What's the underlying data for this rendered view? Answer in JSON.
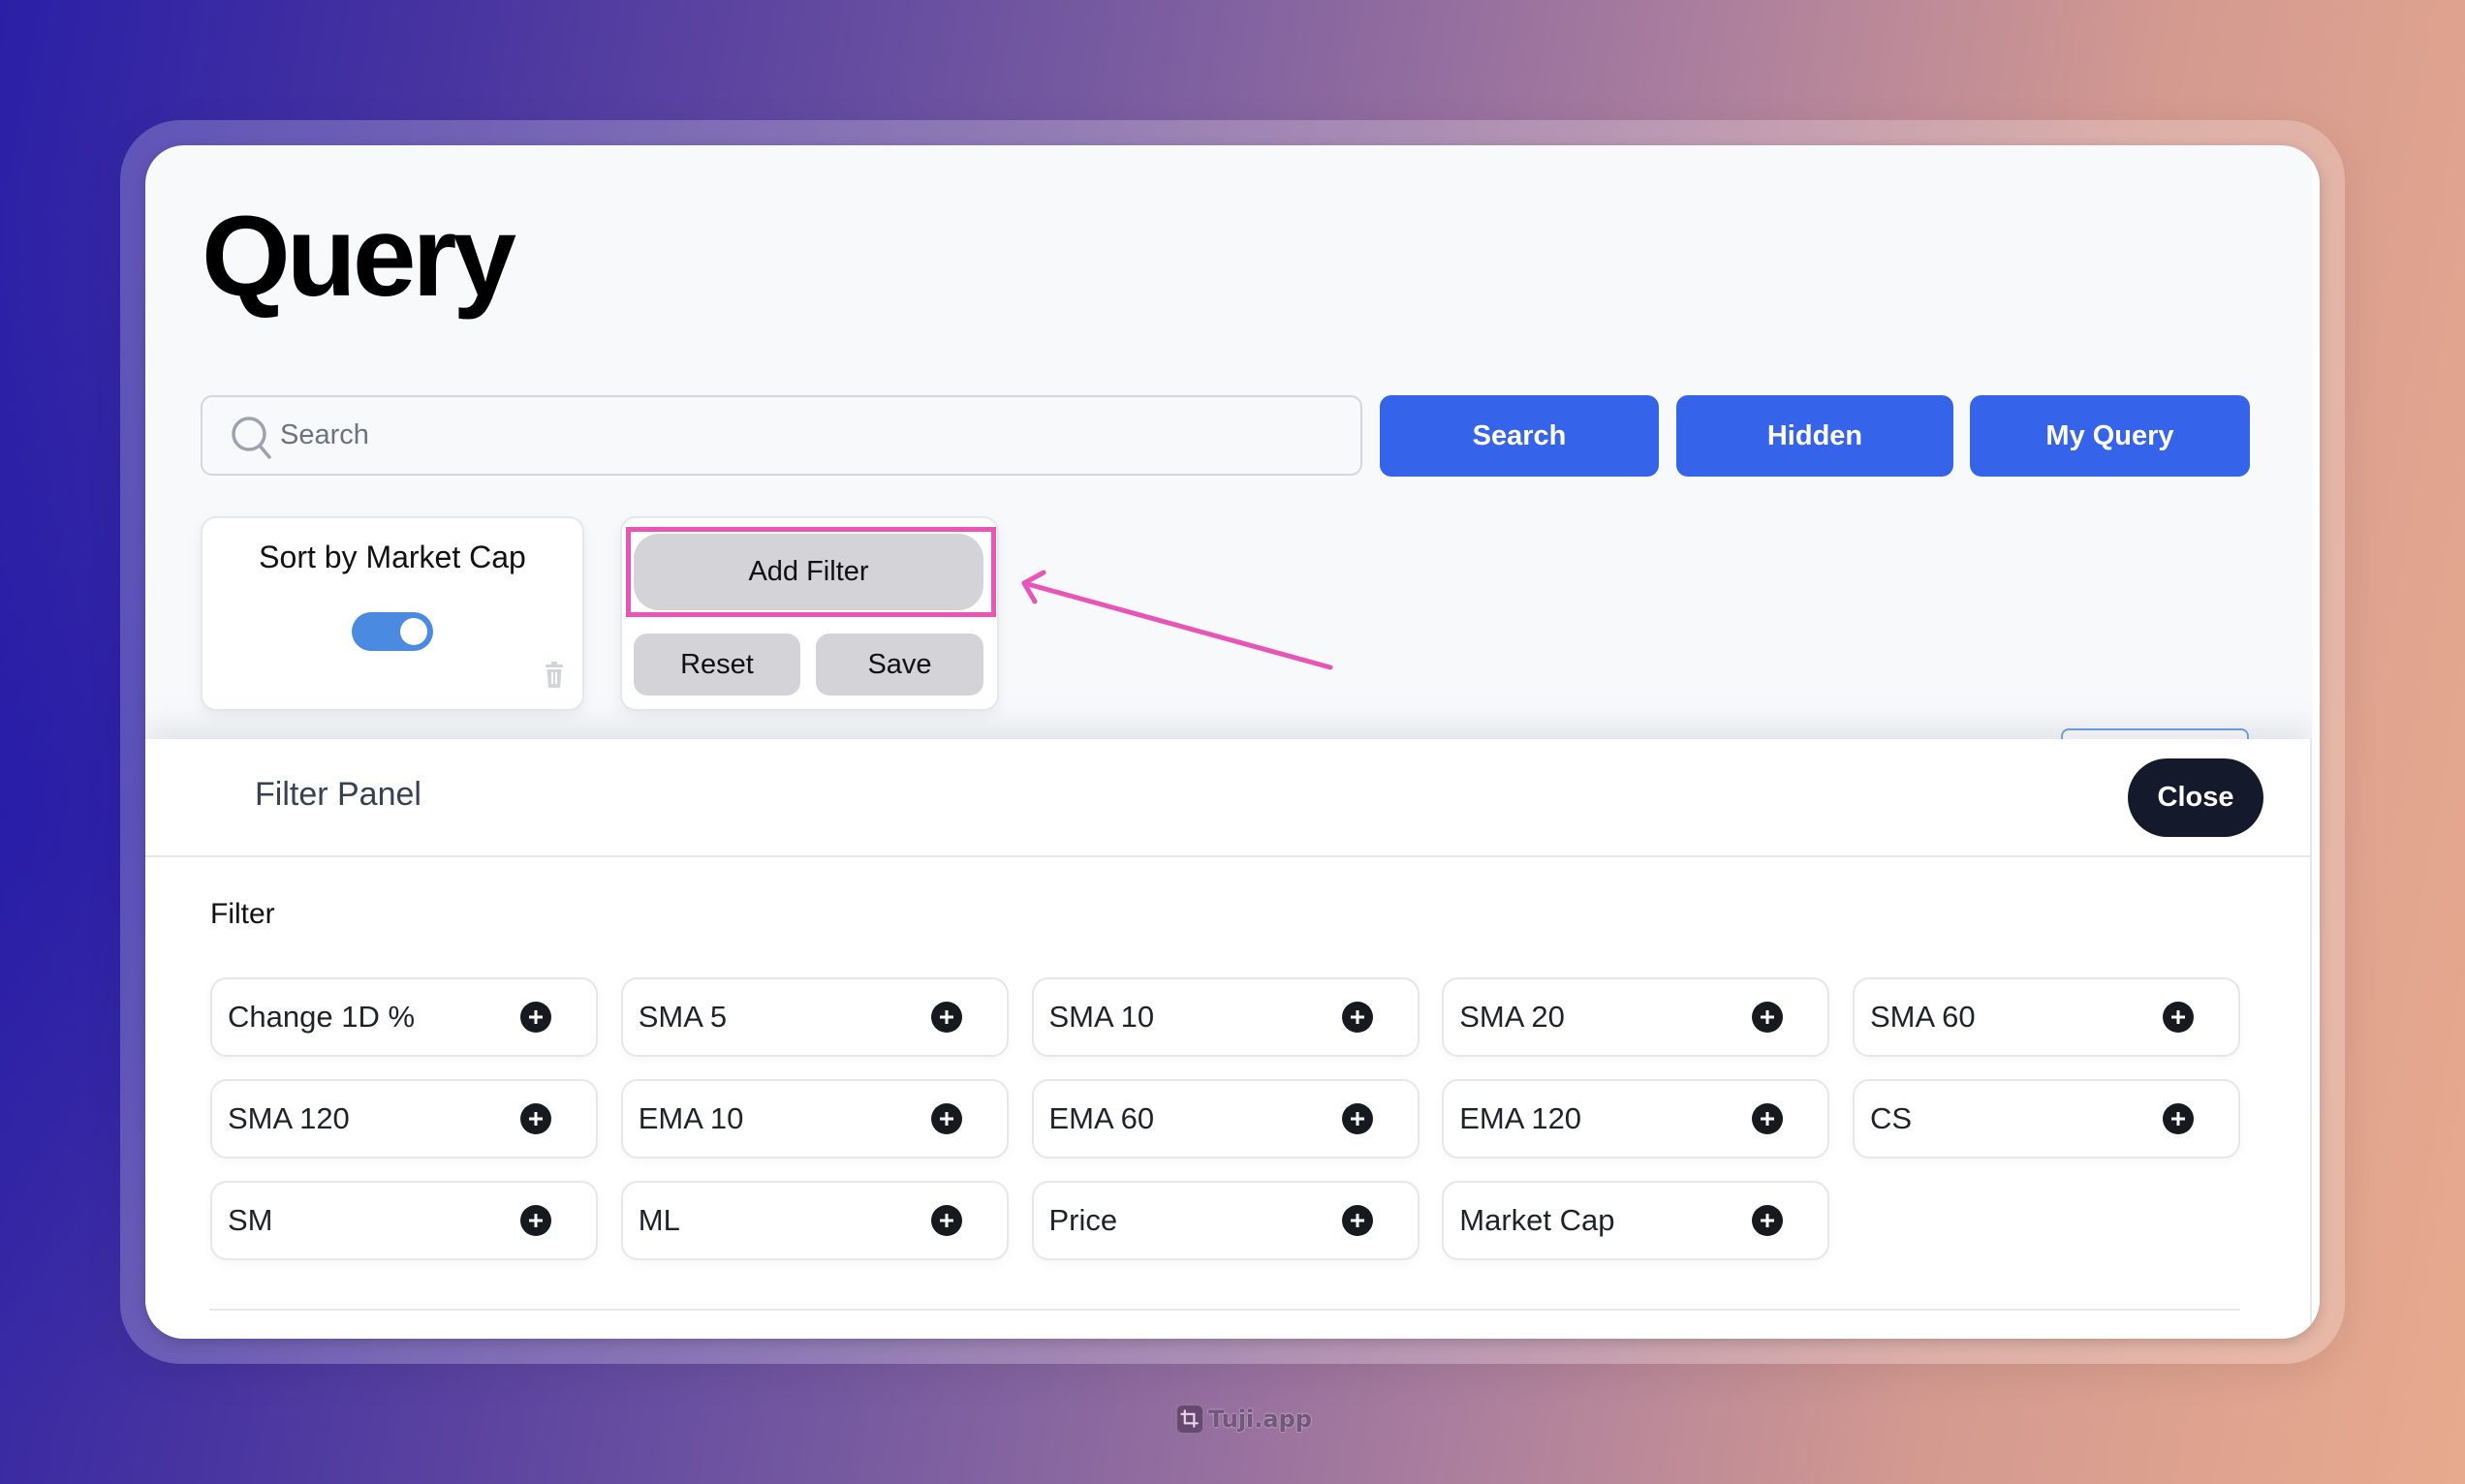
{
  "page": {
    "title": "Query"
  },
  "search": {
    "placeholder": "Search",
    "value": ""
  },
  "toolbar": {
    "search_label": "Search",
    "hidden_label": "Hidden",
    "my_query_label": "My Query"
  },
  "sort_card": {
    "title": "Sort by Market Cap",
    "toggle_on": true
  },
  "filter_actions": {
    "add_filter_label": "Add Filter",
    "reset_label": "Reset",
    "save_label": "Save"
  },
  "annotation": {
    "highlight_color": "#e855b4",
    "target": "Add Filter"
  },
  "filter_panel": {
    "title": "Filter Panel",
    "close_label": "Close",
    "section_label": "Filter",
    "items": [
      {
        "label": "Change 1D %"
      },
      {
        "label": "SMA 5"
      },
      {
        "label": "SMA 10"
      },
      {
        "label": "SMA 20"
      },
      {
        "label": "SMA 60"
      },
      {
        "label": "SMA 120"
      },
      {
        "label": "EMA 10"
      },
      {
        "label": "EMA 60"
      },
      {
        "label": "EMA 120"
      },
      {
        "label": "CS"
      },
      {
        "label": "SM"
      },
      {
        "label": "ML"
      },
      {
        "label": "Price"
      },
      {
        "label": "Market Cap"
      }
    ]
  },
  "colors": {
    "primary": "#3563e9",
    "toggle": "#4a8ae0",
    "close_button": "#141a2b",
    "annotation": "#e855b4"
  },
  "watermark": {
    "text": "Tuji.app"
  }
}
